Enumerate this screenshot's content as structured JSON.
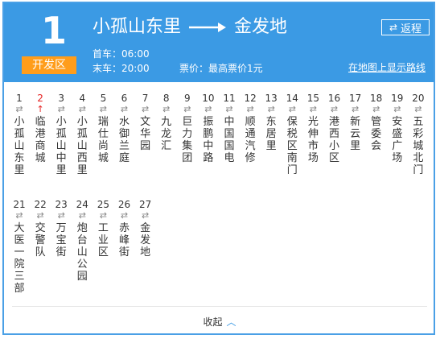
{
  "route": {
    "number": "1",
    "zone_badge": "开发区",
    "from": "小孤山东里",
    "to": "金发地",
    "reverse_label": "返程",
    "first_bus": "首车：06:00",
    "last_bus": "末车：20:00",
    "fare": "票价：最高票价1元",
    "map_link": "在地图上显示路线"
  },
  "colors": {
    "header": "#3b9ae4",
    "badge": "#ff9d1b",
    "highlight": "#e52222"
  },
  "stops": [
    {
      "num": "1",
      "name": "小孤山东里"
    },
    {
      "num": "2",
      "name": "临港商城",
      "current": true
    },
    {
      "num": "3",
      "name": "小孤山中里"
    },
    {
      "num": "4",
      "name": "小孤山西里"
    },
    {
      "num": "5",
      "name": "瑞仕尚城"
    },
    {
      "num": "6",
      "name": "水御兰庭"
    },
    {
      "num": "7",
      "name": "文华园"
    },
    {
      "num": "8",
      "name": "九龙汇"
    },
    {
      "num": "9",
      "name": "巨力集团"
    },
    {
      "num": "10",
      "name": "振鹏中路"
    },
    {
      "num": "11",
      "name": "中国国电"
    },
    {
      "num": "12",
      "name": "顺通汽修"
    },
    {
      "num": "13",
      "name": "东居里"
    },
    {
      "num": "14",
      "name": "保税区南门"
    },
    {
      "num": "15",
      "name": "光伸市场"
    },
    {
      "num": "16",
      "name": "港西小区"
    },
    {
      "num": "17",
      "name": "新云里"
    },
    {
      "num": "18",
      "name": "管委会"
    },
    {
      "num": "19",
      "name": "安盛广场"
    },
    {
      "num": "20",
      "name": "五彩城北门"
    },
    {
      "num": "21",
      "name": "大医一院三部"
    },
    {
      "num": "22",
      "name": "交警队"
    },
    {
      "num": "23",
      "name": "万宝街"
    },
    {
      "num": "24",
      "name": "炮台山公园"
    },
    {
      "num": "25",
      "name": "工业区"
    },
    {
      "num": "26",
      "name": "赤峰街"
    },
    {
      "num": "27",
      "name": "金发地"
    }
  ],
  "footer": {
    "collapse_label": "收起"
  }
}
